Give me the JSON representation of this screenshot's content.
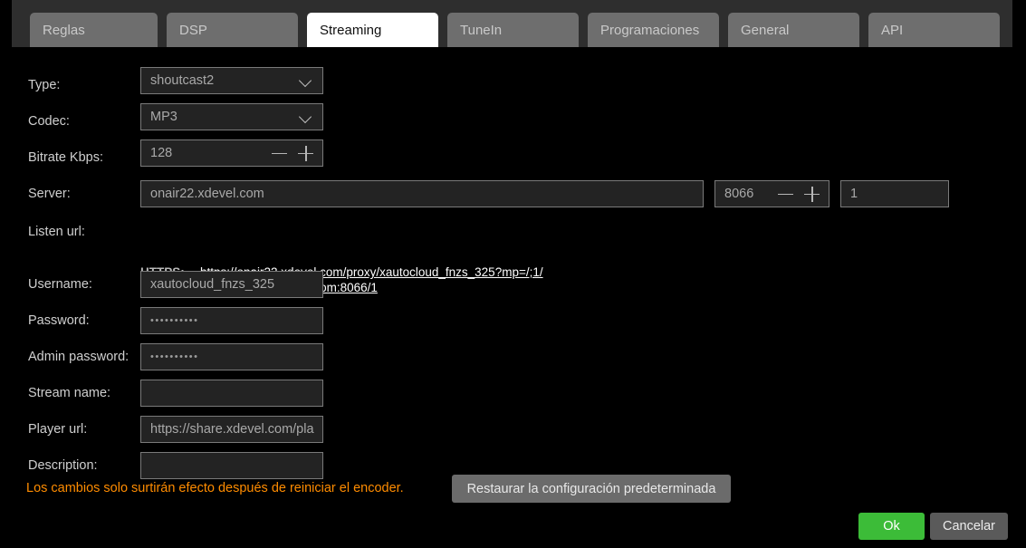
{
  "tabs": [
    {
      "label": "Reglas",
      "active": false
    },
    {
      "label": "DSP",
      "active": false
    },
    {
      "label": "Streaming",
      "active": true
    },
    {
      "label": "TuneIn",
      "active": false
    },
    {
      "label": "Programaciones",
      "active": false
    },
    {
      "label": "General",
      "active": false
    },
    {
      "label": "API",
      "active": false
    }
  ],
  "form": {
    "type": {
      "label": "Type:",
      "value": "shoutcast2"
    },
    "codec": {
      "label": "Codec:",
      "value": "MP3"
    },
    "bitrate": {
      "label": "Bitrate Kbps:",
      "value": "128"
    },
    "server": {
      "label": "Server:",
      "value": "onair22.xdevel.com"
    },
    "port": {
      "value": "8066"
    },
    "mount": {
      "value": "1"
    },
    "listen_url": {
      "label": "Listen url:"
    },
    "username": {
      "label": "Username:",
      "value": "xautocloud_fnzs_325"
    },
    "password": {
      "label": "Password:",
      "value": "••••••••••"
    },
    "admin_password": {
      "label": "Admin password:",
      "value": "••••••••••"
    },
    "stream_name": {
      "label": "Stream name:",
      "value": ""
    },
    "player_url": {
      "label": "Player url:",
      "value": "https://share.xdevel.com/pla"
    },
    "description": {
      "label": "Description:",
      "value": ""
    }
  },
  "listen_urls": [
    {
      "scheme": "HTTPS:",
      "url": "https://onair22.xdevel.com/proxy/xautocloud_fnzs_325?mp=/;1/"
    },
    {
      "scheme": "HTTP:",
      "url": "http://onair22.xdevel.com:8066/1"
    }
  ],
  "footer": {
    "warning": "Los cambios solo surtirán efecto después de reiniciar el encoder.",
    "restore_label": "Restaurar la configuración predeterminada",
    "ok_label": "Ok",
    "cancel_label": "Cancelar"
  },
  "colors": {
    "accent_ok": "#3cbc38",
    "warning": "#ff8c00",
    "tabbar": "#2e2e2e",
    "tab_inactive": "#6e6e6e",
    "tab_active": "#ffffff",
    "field_bg": "#232323",
    "field_border": "#7a7a7a"
  }
}
